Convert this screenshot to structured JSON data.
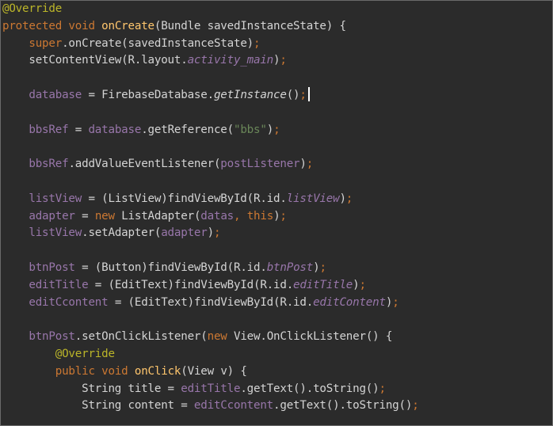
{
  "editor": {
    "lines": [
      [
        {
          "t": "@Override",
          "c": "ann"
        }
      ],
      [
        {
          "t": "protected ",
          "c": "kw"
        },
        {
          "t": "void ",
          "c": "kw"
        },
        {
          "t": "onCreate",
          "c": "fn"
        },
        {
          "t": "(Bundle savedInstanceState) {",
          "c": "txt"
        }
      ],
      [
        {
          "t": "    ",
          "c": "txt"
        },
        {
          "t": "super",
          "c": "kw"
        },
        {
          "t": ".onCreate(savedInstanceState)",
          "c": "txt"
        },
        {
          "t": ";",
          "c": "punc"
        }
      ],
      [
        {
          "t": "    setContentView(R.layout.",
          "c": "txt"
        },
        {
          "t": "activity_main",
          "c": "sfld"
        },
        {
          "t": ")",
          "c": "txt"
        },
        {
          "t": ";",
          "c": "punc"
        }
      ],
      [],
      [
        {
          "t": "    ",
          "c": "txt"
        },
        {
          "t": "database",
          "c": "fld"
        },
        {
          "t": " = FirebaseDatabase.",
          "c": "txt"
        },
        {
          "t": "getInstance",
          "c": "sm"
        },
        {
          "t": "()",
          "c": "txt"
        },
        {
          "t": ";",
          "c": "punc"
        }
      ],
      [],
      [
        {
          "t": "    ",
          "c": "txt"
        },
        {
          "t": "bbsRef",
          "c": "fld"
        },
        {
          "t": " = ",
          "c": "txt"
        },
        {
          "t": "database",
          "c": "fld"
        },
        {
          "t": ".getReference(",
          "c": "txt"
        },
        {
          "t": "\"bbs\"",
          "c": "str"
        },
        {
          "t": ")",
          "c": "txt"
        },
        {
          "t": ";",
          "c": "punc"
        }
      ],
      [],
      [
        {
          "t": "    ",
          "c": "txt"
        },
        {
          "t": "bbsRef",
          "c": "fld"
        },
        {
          "t": ".addValueEventListener(",
          "c": "txt"
        },
        {
          "t": "postListener",
          "c": "fld"
        },
        {
          "t": ")",
          "c": "txt"
        },
        {
          "t": ";",
          "c": "punc"
        }
      ],
      [],
      [
        {
          "t": "    ",
          "c": "txt"
        },
        {
          "t": "listView",
          "c": "fld"
        },
        {
          "t": " = (ListView)findViewById(R.id.",
          "c": "txt"
        },
        {
          "t": "listView",
          "c": "sfld"
        },
        {
          "t": ")",
          "c": "txt"
        },
        {
          "t": ";",
          "c": "punc"
        }
      ],
      [
        {
          "t": "    ",
          "c": "txt"
        },
        {
          "t": "adapter",
          "c": "fld"
        },
        {
          "t": " = ",
          "c": "txt"
        },
        {
          "t": "new ",
          "c": "kw"
        },
        {
          "t": "ListAdapter(",
          "c": "txt"
        },
        {
          "t": "datas",
          "c": "fld"
        },
        {
          "t": ", ",
          "c": "punc"
        },
        {
          "t": "this",
          "c": "kw"
        },
        {
          "t": ")",
          "c": "txt"
        },
        {
          "t": ";",
          "c": "punc"
        }
      ],
      [
        {
          "t": "    ",
          "c": "txt"
        },
        {
          "t": "listView",
          "c": "fld"
        },
        {
          "t": ".setAdapter(",
          "c": "txt"
        },
        {
          "t": "adapter",
          "c": "fld"
        },
        {
          "t": ")",
          "c": "txt"
        },
        {
          "t": ";",
          "c": "punc"
        }
      ],
      [],
      [
        {
          "t": "    ",
          "c": "txt"
        },
        {
          "t": "btnPost",
          "c": "fld"
        },
        {
          "t": " = (Button)findViewById(R.id.",
          "c": "txt"
        },
        {
          "t": "btnPost",
          "c": "sfld"
        },
        {
          "t": ")",
          "c": "txt"
        },
        {
          "t": ";",
          "c": "punc"
        }
      ],
      [
        {
          "t": "    ",
          "c": "txt"
        },
        {
          "t": "editTitle",
          "c": "fld"
        },
        {
          "t": " = (EditText)findViewById(R.id.",
          "c": "txt"
        },
        {
          "t": "editTitle",
          "c": "sfld"
        },
        {
          "t": ")",
          "c": "txt"
        },
        {
          "t": ";",
          "c": "punc"
        }
      ],
      [
        {
          "t": "    ",
          "c": "txt"
        },
        {
          "t": "editCcontent",
          "c": "fld"
        },
        {
          "t": " = (EditText)findViewById(R.id.",
          "c": "txt"
        },
        {
          "t": "editContent",
          "c": "sfld"
        },
        {
          "t": ")",
          "c": "txt"
        },
        {
          "t": ";",
          "c": "punc"
        }
      ],
      [],
      [
        {
          "t": "    ",
          "c": "txt"
        },
        {
          "t": "btnPost",
          "c": "fld"
        },
        {
          "t": ".setOnClickListener(",
          "c": "txt"
        },
        {
          "t": "new ",
          "c": "kw"
        },
        {
          "t": "View.OnClickListener() {",
          "c": "txt"
        }
      ],
      [
        {
          "t": "        ",
          "c": "txt"
        },
        {
          "t": "@Override",
          "c": "ann"
        }
      ],
      [
        {
          "t": "        ",
          "c": "txt"
        },
        {
          "t": "public ",
          "c": "kw"
        },
        {
          "t": "void ",
          "c": "kw"
        },
        {
          "t": "onClick",
          "c": "fn"
        },
        {
          "t": "(View v) {",
          "c": "txt"
        }
      ],
      [
        {
          "t": "            String title = ",
          "c": "txt"
        },
        {
          "t": "editTitle",
          "c": "fld"
        },
        {
          "t": ".getText().toString()",
          "c": "txt"
        },
        {
          "t": ";",
          "c": "punc"
        }
      ],
      [
        {
          "t": "            String content = ",
          "c": "txt"
        },
        {
          "t": "editCcontent",
          "c": "fld"
        },
        {
          "t": ".getText().toString()",
          "c": "txt"
        },
        {
          "t": ";",
          "c": "punc"
        }
      ]
    ],
    "colors": {
      "background": "#2b2b2b",
      "annotation": "#bbb529",
      "keyword": "#cc7832",
      "method_declaration": "#ffc66d",
      "field": "#9876aa",
      "string": "#6a8759",
      "text": "#d4d4d4"
    }
  }
}
